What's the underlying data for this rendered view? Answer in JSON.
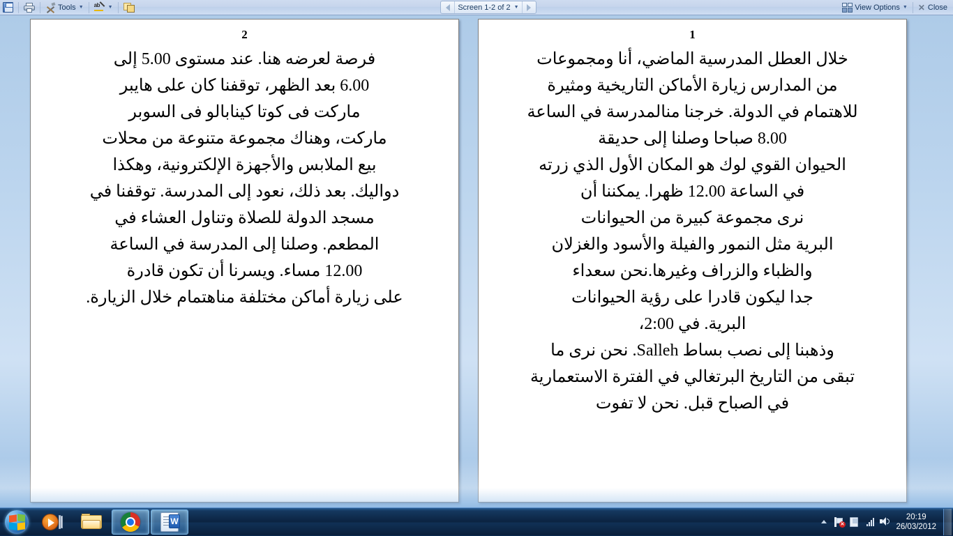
{
  "toolbar": {
    "save_icon": "save-icon",
    "print_icon": "print-icon",
    "tools_label": "Tools",
    "tools_icon": "tools-icon",
    "spelling_icon": "spelling-icon",
    "note_icon": "note-window-icon",
    "screen_label": "Screen 1-2 of 2",
    "prev_icon": "previous-screen-arrow-icon",
    "next_icon": "next-screen-arrow-icon",
    "view_options_label": "View Options",
    "view_options_icon": "view-options-icon",
    "close_label": "Close",
    "close_icon": "close-x-icon"
  },
  "document": {
    "pages": [
      {
        "number": "2",
        "lines": [
          "فرصة لعرضه هنا. عند مستوى 5.00 إلى",
          "6.00 بعد الظهر، توقفنا كان على هايبر",
          "ماركت فى كوتا كينابالو فى السوبر",
          "ماركت، وهناك مجموعة متنوعة من محلات",
          "بيع الملابس والأجهزة الإلكترونية، وهكذا",
          "دواليك. بعد ذلك، نعود إلى المدرسة. توقفنا في",
          "مسجد الدولة للصلاة وتناول العشاء في",
          "المطعم. وصلنا إلى المدرسة في الساعة",
          "12.00 مساء. ويسرنا أن تكون قادرة",
          "على زيارة أماكن مختلفة مناهتمام خلال الزيارة."
        ]
      },
      {
        "number": "1",
        "lines": [
          "خلال العطل المدرسية الماضي، أنا ومجموعات",
          "من المدارس زيارة الأماكن التاريخية ومثيرة",
          "للاهتمام في الدولة. خرجنا منالمدرسة في الساعة",
          "8.00 صباحا وصلنا إلى حديقة",
          "الحيوان القوي لوك هو المكان الأول الذي زرته",
          "في الساعة 12.00 ظهرا. يمكننا أن",
          "نرى مجموعة كبيرة من الحيوانات",
          "البرية مثل النمور والفيلة والأسود والغزلان",
          "والظباء والزراف وغيرها.نحن سعداء",
          "جدا ليكون قادرا على رؤية الحيوانات",
          "البرية. في 2:00،",
          "وذهبنا إلى نصب بساط Salleh. نحن نرى ما",
          "تبقى من التاريخ البرتغالي في الفترة الاستعمارية",
          "في الصباح قبل. نحن لا تفوت"
        ]
      }
    ]
  },
  "taskbar": {
    "start_icon": "windows-start-orb-icon",
    "items": [
      {
        "name": "media-player",
        "icon": "windows-media-player-icon",
        "active": false
      },
      {
        "name": "file-explorer",
        "icon": "folder-explorer-icon",
        "active": false
      },
      {
        "name": "google-chrome",
        "icon": "chrome-icon",
        "active": true
      },
      {
        "name": "microsoft-word",
        "icon": "word-icon",
        "active": true
      }
    ],
    "tray": {
      "show_hidden_icon": "show-hidden-icons-arrow",
      "network_icon": "network-disconnected-icon",
      "action_center_icon": "action-center-flag-icon",
      "signal_icon": "signal-bars-icon",
      "volume_icon": "volume-speaker-icon"
    },
    "clock": {
      "time": "20:19",
      "date": "26/03/2012"
    },
    "show_desktop": "show-desktop-button"
  },
  "colors": {
    "toolbar_text": "#17375e",
    "taskbar": "#0b2341",
    "page_background": "#ffffff",
    "workspace": "#bcd5ee"
  }
}
